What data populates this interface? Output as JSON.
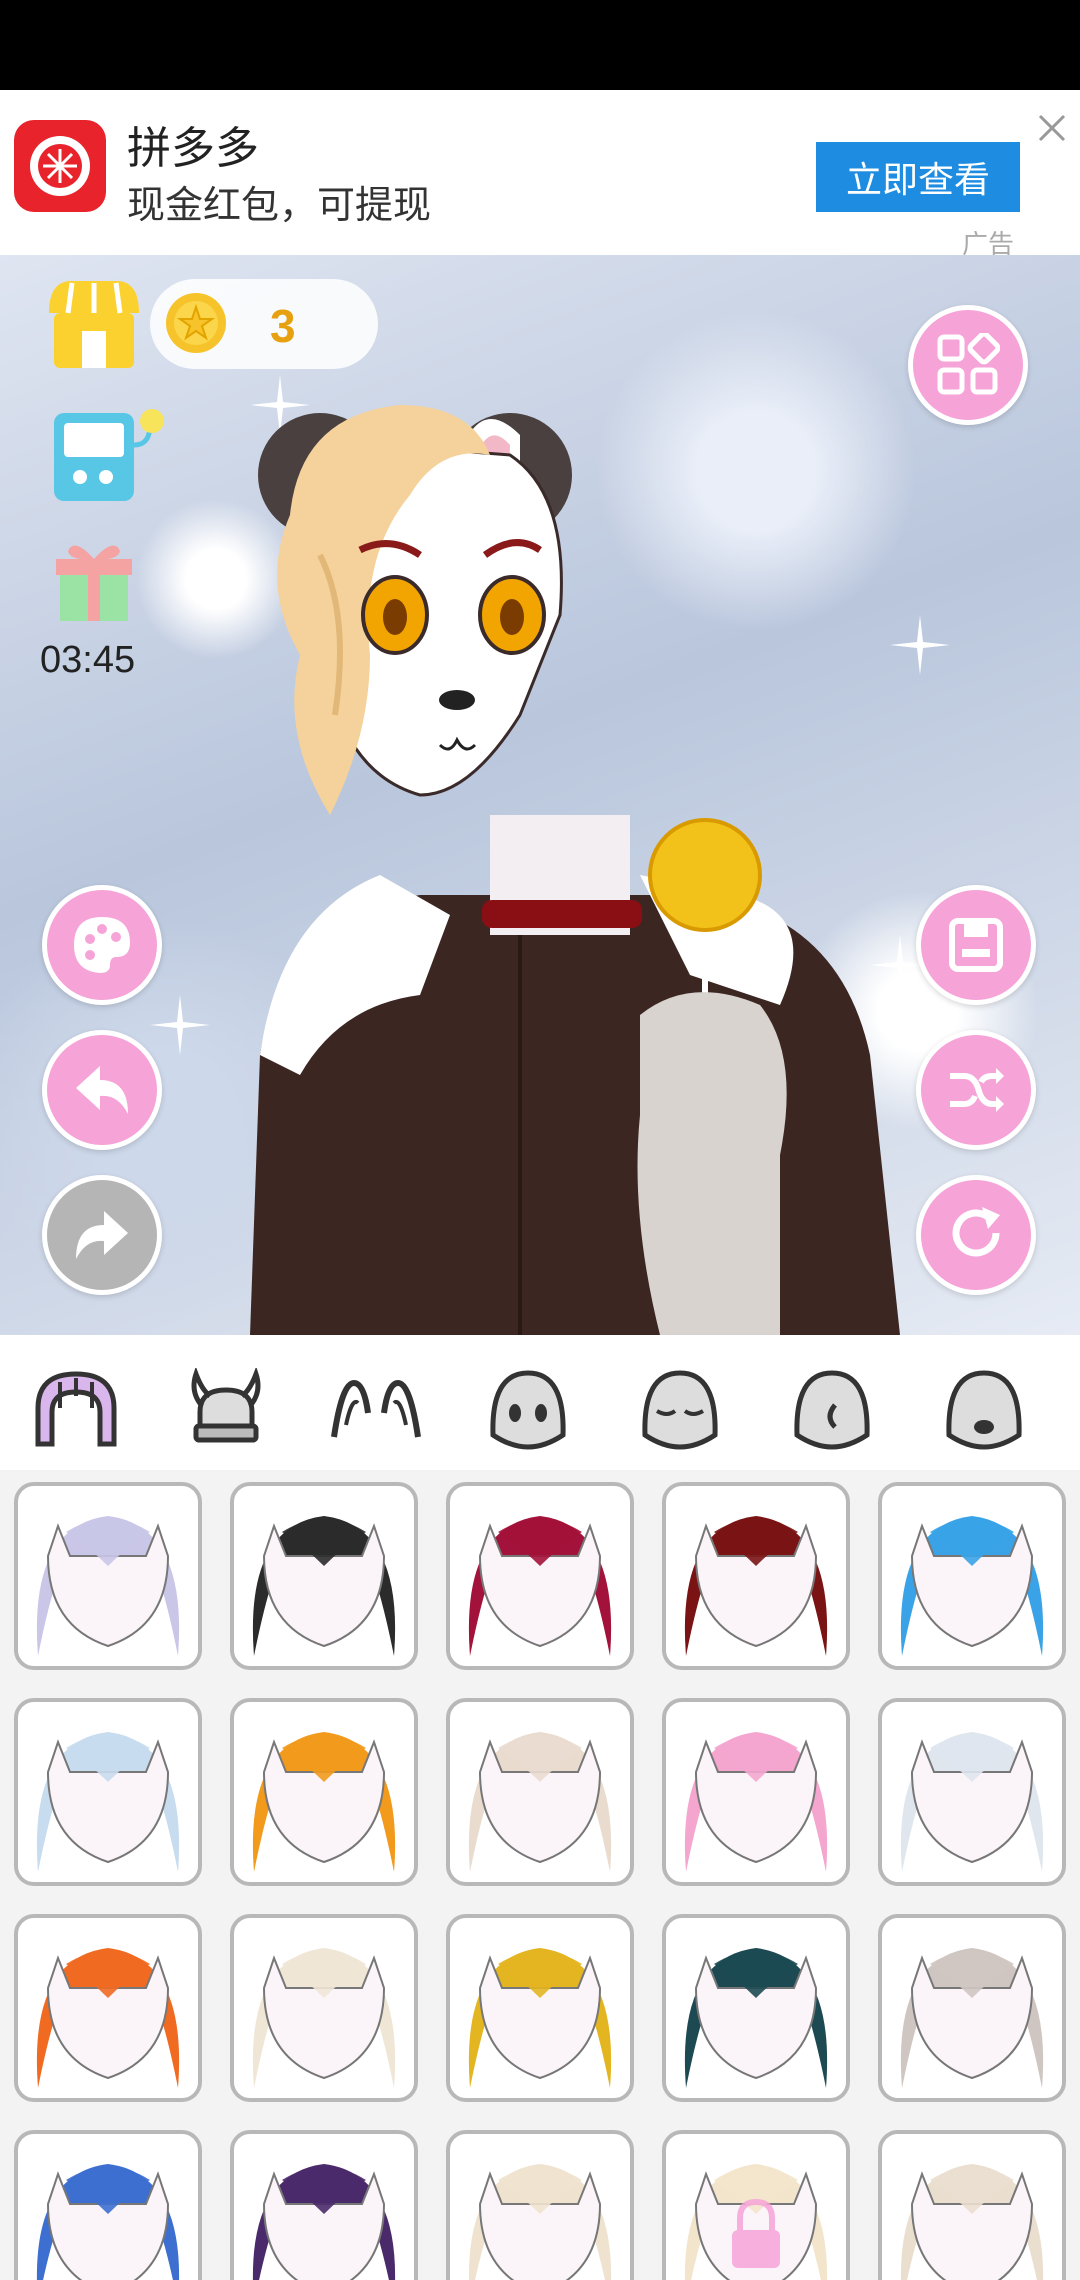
{
  "ad": {
    "title": "拼多多",
    "subtitle": "现金红包，可提现",
    "button_label": "立即查看",
    "tag": "广告",
    "brand_color": "#e8232b",
    "button_color": "#1e8de1"
  },
  "hud": {
    "coin_count": "3",
    "timer": "03:45",
    "accent_color": "#f6a3d8"
  },
  "left_buttons": [
    {
      "name": "palette-button",
      "icon": "palette-icon"
    },
    {
      "name": "undo-button",
      "icon": "undo-arrow-icon"
    },
    {
      "name": "redo-button",
      "icon": "redo-arrow-icon",
      "disabled": true
    }
  ],
  "right_buttons": [
    {
      "name": "save-button",
      "icon": "save-icon"
    },
    {
      "name": "shuffle-button",
      "icon": "shuffle-icon"
    },
    {
      "name": "reset-button",
      "icon": "refresh-icon"
    }
  ],
  "category_tabs": [
    {
      "name": "hair",
      "icon": "hair-icon",
      "selected": true
    },
    {
      "name": "horns",
      "icon": "horns-helmet-icon"
    },
    {
      "name": "ears",
      "icon": "ears-icon"
    },
    {
      "name": "face-eyes",
      "icon": "face-eyes-icon"
    },
    {
      "name": "face-closed-eyes",
      "icon": "face-closed-eyes-icon"
    },
    {
      "name": "face-side",
      "icon": "face-side-icon"
    },
    {
      "name": "face-mouth",
      "icon": "face-mouth-icon"
    }
  ],
  "hair_options": [
    {
      "color": "#c9c6e8",
      "locked": false
    },
    {
      "color": "#2b2b2b",
      "locked": false
    },
    {
      "color": "#a3123a",
      "locked": false
    },
    {
      "color": "#7a1414",
      "locked": false,
      "selected": true
    },
    {
      "color": "#3aa3e8",
      "locked": false
    },
    {
      "color": "#c8dcef",
      "locked": false
    },
    {
      "color": "#f29a1c",
      "locked": false
    },
    {
      "color": "#eadbcf",
      "locked": false
    },
    {
      "color": "#f4a6cf",
      "locked": false
    },
    {
      "color": "#dfe6ee",
      "locked": false
    },
    {
      "color": "#f06a22",
      "locked": false
    },
    {
      "color": "#efe6d6",
      "locked": false
    },
    {
      "color": "#e3b521",
      "locked": false
    },
    {
      "color": "#1d4a52",
      "locked": false
    },
    {
      "color": "#cfc6c2",
      "locked": false
    },
    {
      "color": "#3d6fd0",
      "locked": false
    },
    {
      "color": "#4a2a6a",
      "locked": false
    },
    {
      "color": "#efe3cf",
      "locked": false
    },
    {
      "color": "#f3e5cc",
      "locked": true
    },
    {
      "color": "#eadfcf",
      "locked": false
    }
  ]
}
